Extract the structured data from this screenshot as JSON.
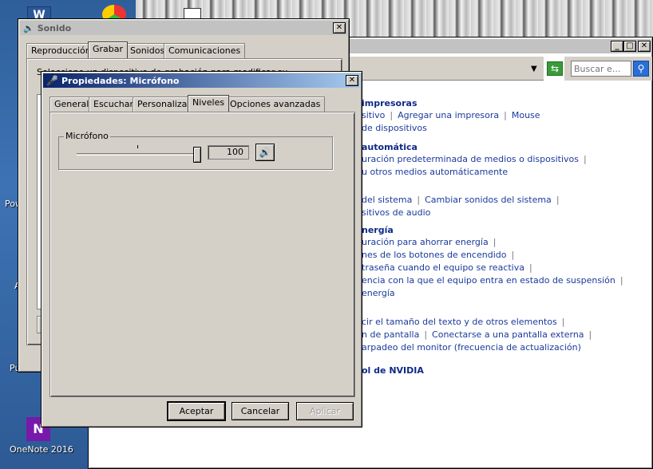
{
  "desktop": {
    "icons": [
      {
        "label": "Pow"
      },
      {
        "label": "A"
      },
      {
        "label": "Pu"
      },
      {
        "label": "OneNote 2016"
      }
    ]
  },
  "control_panel": {
    "search_placeholder": "Buscar e...",
    "sections": [
      {
        "heading": "impresoras",
        "lines": [
          [
            "sitivo",
            "Agregar una impresora",
            "Mouse"
          ],
          [
            "de dispositivos"
          ]
        ]
      },
      {
        "heading": "automática",
        "lines": [
          [
            "uración predeterminada de medios o dispositivos"
          ],
          [
            "u otros medios automáticamente"
          ]
        ]
      },
      {
        "heading": "",
        "lines": [
          [
            "del sistema",
            "Cambiar sonidos del sistema"
          ],
          [
            "sitivos de audio"
          ]
        ]
      },
      {
        "heading": "nergía",
        "lines": [
          [
            "uración para ahorrar energía"
          ],
          [
            "nes de los botones de encendido"
          ],
          [
            "traseña cuando el equipo se reactiva"
          ],
          [
            "encia con la que el equipo entra en estado de suspensión"
          ],
          [
            "energía"
          ]
        ]
      },
      {
        "heading": "",
        "lines": [
          [
            "cir el tamaño del texto y de otros elementos"
          ],
          [
            "n de pantalla",
            "Conectarse a una pantalla externa"
          ],
          [
            "arpadeo del monitor (frecuencia de actualización)"
          ]
        ]
      },
      {
        "heading": "ol de NVIDIA",
        "lines": []
      }
    ]
  },
  "sound_window": {
    "title": "Sonido",
    "tabs": [
      "Reproducción",
      "Grabar",
      "Sonidos",
      "Comunicaciones"
    ],
    "selected_tab": "Grabar",
    "partial_text": "Seleccione un dispositivo de grabación para modificar su"
  },
  "mic_window": {
    "title": "Propiedades: Micrófono",
    "tabs": [
      "General",
      "Escuchar",
      "Personalizar",
      "Niveles",
      "Opciones avanzadas"
    ],
    "selected_tab": "Niveles",
    "group_label": "Micrófono",
    "level_value": "100",
    "level_fraction": 1.0,
    "buttons": {
      "ok": "Aceptar",
      "cancel": "Cancelar",
      "apply": "Aplicar"
    }
  },
  "colors": {
    "link": "#1a3a9c",
    "heading": "#0e2a88",
    "active_title": "#0a246a"
  }
}
